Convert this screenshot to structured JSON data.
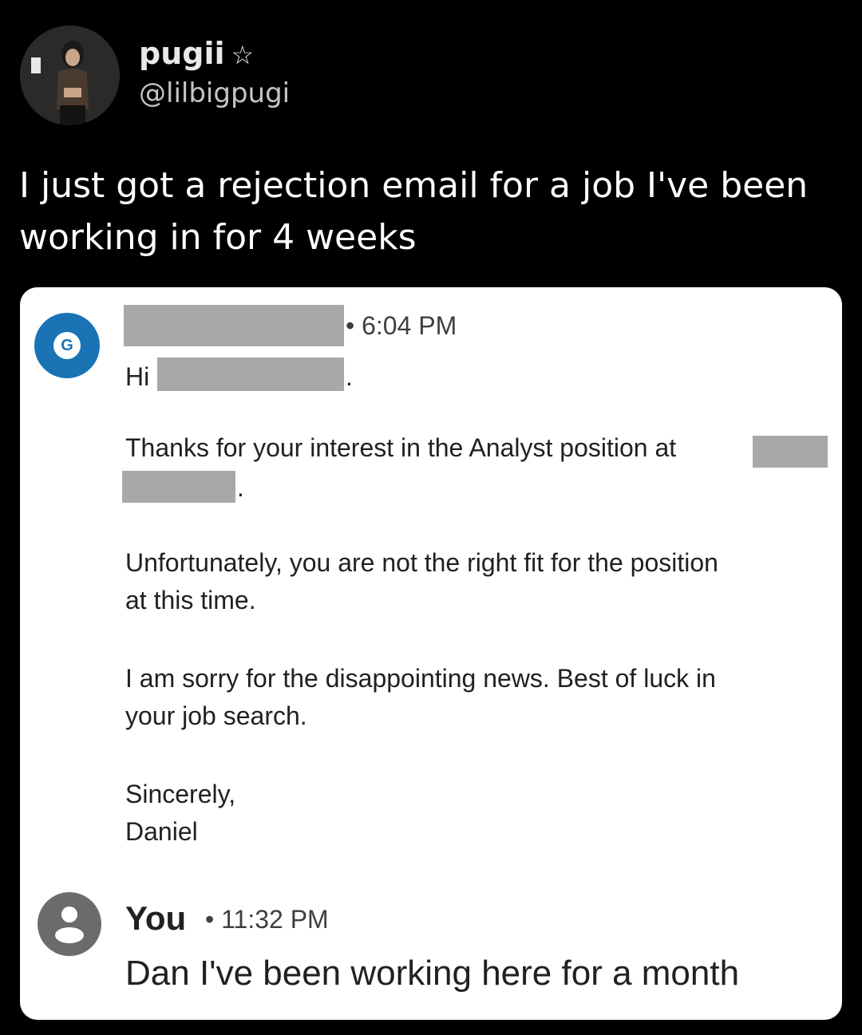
{
  "tweet": {
    "display_name": "pugii",
    "badge": "☆",
    "handle": "@lilbigpugi",
    "text_line1": "I just got a rejection email for a job I've been",
    "text_line2": "working in for 4 weeks"
  },
  "email": {
    "sender_initial": "G",
    "sent_time": "• 6:04 PM",
    "greeting": "Hi",
    "period": ".",
    "body_line1": "Thanks for your interest in the Analyst position at",
    "body_line2_period": ".",
    "body_line3": "Unfortunately, you are not the right fit for the position",
    "body_line4": "at this time.",
    "body_line5": "I am sorry for the disappointing news. Best of luck in",
    "body_line6": "your job search.",
    "sign_off": "Sincerely,",
    "signature": "Daniel"
  },
  "reply": {
    "sender": "You",
    "time": "• 11:32 PM",
    "text": "Dan I've been working here for a month"
  },
  "colors": {
    "background": "#000000",
    "card": "#ffffff",
    "gmail_blue": "#1a73b5",
    "redaction": "#a8a8a8"
  }
}
